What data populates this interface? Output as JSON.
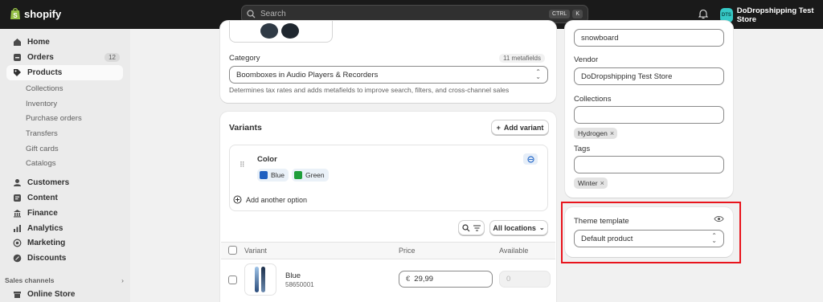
{
  "topbar": {
    "brand": "shopify",
    "search_placeholder": "Search",
    "shortcut_ctrl": "CTRL",
    "shortcut_key": "K",
    "store_initials": "DTS",
    "store_name": "DoDropshipping Test Store"
  },
  "sidebar": {
    "home": "Home",
    "orders": "Orders",
    "orders_count": "12",
    "products": "Products",
    "sub": [
      "Collections",
      "Inventory",
      "Purchase orders",
      "Transfers",
      "Gift cards",
      "Catalogs"
    ],
    "customers": "Customers",
    "content": "Content",
    "finance": "Finance",
    "analytics": "Analytics",
    "marketing": "Marketing",
    "discounts": "Discounts",
    "sales_channels": "Sales channels",
    "online_store": "Online Store"
  },
  "category": {
    "label": "Category",
    "metafields": "11 metafields",
    "value": "Boomboxes in Audio Players & Recorders",
    "help": "Determines tax rates and adds metafields to improve search, filters, and cross-channel sales"
  },
  "variants": {
    "title": "Variants",
    "add_variant": "Add variant",
    "option_name": "Color",
    "option_values": [
      {
        "label": "Blue",
        "color": "#1f5fbf"
      },
      {
        "label": "Green",
        "color": "#1f9e3a"
      }
    ],
    "add_option": "Add another option",
    "filter": "All locations",
    "col_variant": "Variant",
    "col_price": "Price",
    "col_available": "Available",
    "rows": [
      {
        "name": "Blue",
        "sku": "58650001",
        "currency": "€",
        "price": "29,99",
        "available": "0"
      }
    ]
  },
  "organization": {
    "type_value": "snowboard",
    "vendor_label": "Vendor",
    "vendor_value": "DoDropshipping Test Store",
    "collections_label": "Collections",
    "collection_tag": "Hydrogen",
    "tags_label": "Tags",
    "tag": "Winter"
  },
  "theme": {
    "label": "Theme template",
    "value": "Default product"
  },
  "colors": {
    "highlight": "#e8141c",
    "topbar": "#1a1a1a",
    "store_avatar": "#36c9c6"
  }
}
